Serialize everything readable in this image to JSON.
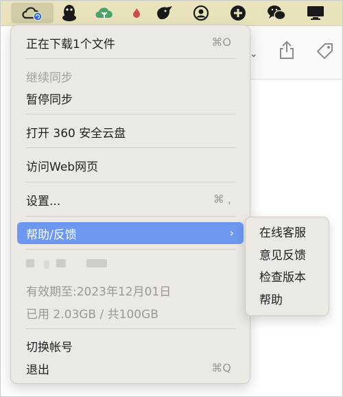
{
  "menubar": {
    "icons": [
      "360-cloud-icon",
      "qq-penguin-icon",
      "cloud-tree-icon",
      "fire-icon",
      "bird-icon",
      "user-circle-icon",
      "add-circle-icon",
      "wechat-icon",
      "display-icon"
    ]
  },
  "background_window": {
    "icons": [
      "share-icon",
      "tag-icon"
    ]
  },
  "menu": {
    "items": [
      {
        "label": "正在下载1个文件",
        "shortcut": "⌘O"
      },
      {
        "label": "继续同步"
      },
      {
        "label": "暂停同步"
      },
      {
        "label": "打开 360 安全云盘"
      },
      {
        "label": "访问Web网页"
      },
      {
        "label": "设置...",
        "shortcut": "⌘ ,"
      },
      {
        "label": "帮助/反馈"
      },
      {
        "label": "切换帐号"
      },
      {
        "label": "退出",
        "shortcut": "⌘Q"
      }
    ],
    "account": {
      "expiry": "有效期至:2023年12月01日",
      "usage": "已用 2.03GB / 共100GB"
    }
  },
  "submenu": {
    "items": [
      "在线客服",
      "意见反馈",
      "检查版本",
      "帮助"
    ]
  },
  "colors": {
    "menubar": "#e9e3bd",
    "highlight": "#6e98f0",
    "menu_bg": "#ece8e4"
  }
}
